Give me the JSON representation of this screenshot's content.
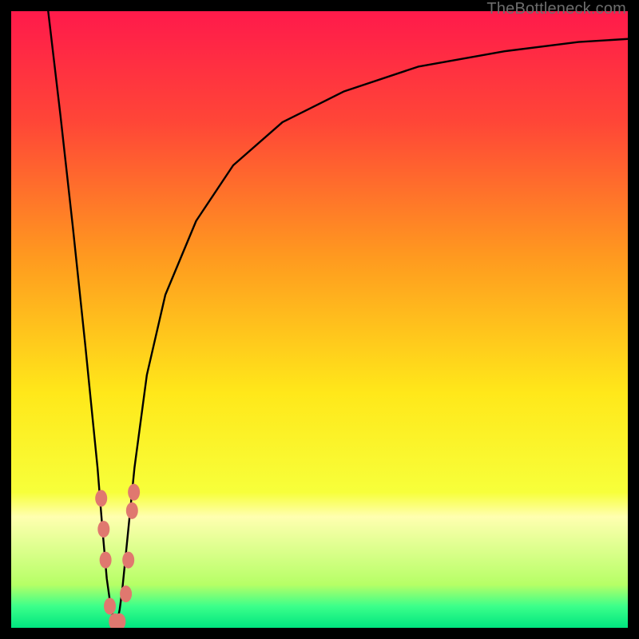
{
  "watermark": "TheBottleneck.com",
  "chart_data": {
    "type": "line",
    "title": "",
    "xlabel": "",
    "ylabel": "",
    "xlim": [
      0,
      100
    ],
    "ylim": [
      0,
      100
    ],
    "background_gradient": {
      "stops": [
        {
          "offset": 0.0,
          "color": "#ff1a4b"
        },
        {
          "offset": 0.18,
          "color": "#ff4637"
        },
        {
          "offset": 0.4,
          "color": "#ff9a1f"
        },
        {
          "offset": 0.62,
          "color": "#ffe81a"
        },
        {
          "offset": 0.78,
          "color": "#f7ff3a"
        },
        {
          "offset": 0.82,
          "color": "#ffffb0"
        },
        {
          "offset": 0.93,
          "color": "#b6ff66"
        },
        {
          "offset": 0.965,
          "color": "#3cff8a"
        },
        {
          "offset": 1.0,
          "color": "#00e57f"
        }
      ]
    },
    "series": [
      {
        "name": "bottleneck-curve",
        "color": "#000000",
        "x": [
          6,
          8,
          10,
          12,
          13,
          14,
          14.8,
          15.5,
          16.2,
          17,
          17.6,
          18,
          18.4,
          19,
          20,
          22,
          25,
          30,
          36,
          44,
          54,
          66,
          80,
          92,
          100
        ],
        "y": [
          100,
          83,
          65,
          46,
          36,
          26,
          16,
          8,
          3,
          0,
          3,
          6,
          10,
          16,
          26,
          41,
          54,
          66,
          75,
          82,
          87,
          91,
          93.5,
          95,
          95.5
        ]
      }
    ],
    "markers": {
      "name": "data-points",
      "color": "#e0786f",
      "points": [
        {
          "x": 14.6,
          "y": 21
        },
        {
          "x": 15.0,
          "y": 16
        },
        {
          "x": 15.3,
          "y": 11
        },
        {
          "x": 16.0,
          "y": 3.5
        },
        {
          "x": 16.8,
          "y": 1.0
        },
        {
          "x": 17.6,
          "y": 1.0
        },
        {
          "x": 18.6,
          "y": 5.5
        },
        {
          "x": 19.0,
          "y": 11
        },
        {
          "x": 19.6,
          "y": 19
        },
        {
          "x": 19.9,
          "y": 22
        }
      ]
    }
  }
}
